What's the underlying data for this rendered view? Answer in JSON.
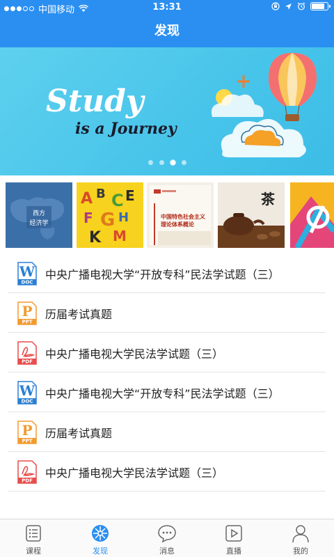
{
  "status_bar": {
    "carrier": "中国移动",
    "time": "13:31",
    "battery_level": 0.85
  },
  "nav": {
    "title": "发现"
  },
  "banner": {
    "headline_line1": "Study",
    "headline_line2": "is a Journey",
    "page_count": 4,
    "active_page": 2
  },
  "thumbnails": [
    {
      "label": "西方\n经济学",
      "icon": "western-economics-cover"
    },
    {
      "label": "",
      "icon": "alphabet-cover"
    },
    {
      "label": "中国特色社会主义\n理论体系概论",
      "icon": "book-cover"
    },
    {
      "label": "茶",
      "icon": "tea-cover"
    },
    {
      "label": "",
      "icon": "colorful-logo-cover"
    }
  ],
  "documents": [
    {
      "type": "DOC",
      "letter": "W",
      "title": "中央广播电视大学“开放专科”民法学试题（三）"
    },
    {
      "type": "PPT",
      "letter": "P",
      "title": "历届考试真题"
    },
    {
      "type": "PDF",
      "letter": "",
      "title": "中央广播电视大学民法学试题（三）"
    },
    {
      "type": "DOC",
      "letter": "W",
      "title": "中央广播电视大学“开放专科”民法学试题（三）"
    },
    {
      "type": "PPT",
      "letter": "P",
      "title": "历届考试真题"
    },
    {
      "type": "PDF",
      "letter": "",
      "title": "中央广播电视大学民法学试题（三）"
    }
  ],
  "tabs": [
    {
      "label": "课程",
      "icon": "course-list-icon",
      "active": false
    },
    {
      "label": "发现",
      "icon": "discover-compass-icon",
      "active": true
    },
    {
      "label": "消息",
      "icon": "message-bubble-icon",
      "active": false
    },
    {
      "label": "直播",
      "icon": "live-play-icon",
      "active": false
    },
    {
      "label": "我的",
      "icon": "profile-person-icon",
      "active": false
    }
  ],
  "colors": {
    "primary": "#2b8ff1",
    "doc": "#2a7fd4",
    "ppt": "#f29a2e",
    "pdf": "#e84c4c"
  }
}
